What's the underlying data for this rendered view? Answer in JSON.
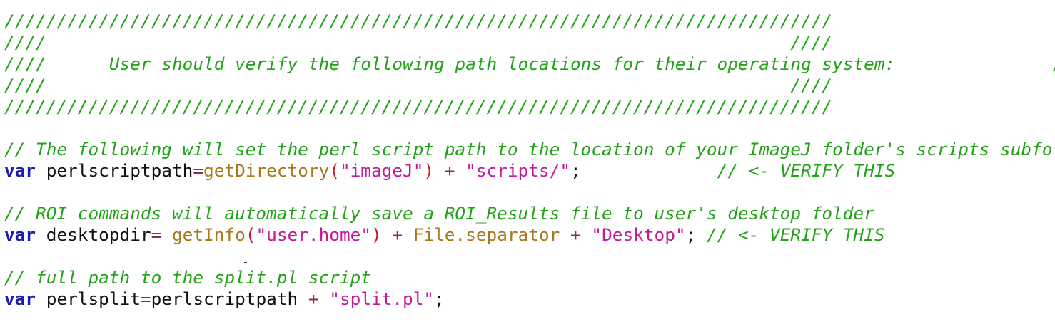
{
  "editor": {
    "colors": {
      "comment": "#22a317",
      "keyword": "#1d1dad",
      "function": "#a8791a",
      "string": "#c41a9a",
      "paren": "#c41a2b",
      "operator": "#8a2b5a"
    },
    "banner": {
      "border": "///////////////////////////////////////////////////////////////////////////////",
      "blank": "////                                                                       ////",
      "message": "////      User should verify the following path locations for their operating system:               ////"
    },
    "block1": {
      "comment": "// The following will set the perl script path to the location of your ImageJ folder's scripts subfolder",
      "keyword": "var",
      "name": "perlscriptpath",
      "eq": "=",
      "fn": "getDirectory",
      "popen": "(",
      "arg": "\"imageJ\"",
      "pclose": ")",
      "plus": " + ",
      "str": "\"scripts/\"",
      "semi": ";",
      "pad": "             ",
      "trail": "// <- VERIFY THIS"
    },
    "block2": {
      "comment": "// ROI commands will automatically save a ROI_Results file to user's desktop folder",
      "keyword": "var",
      "name": "desktopdir",
      "eq": "= ",
      "fn": "getInfo",
      "popen": "(",
      "arg": "\"user.home\"",
      "pclose": ")",
      "plus1": " + ",
      "ref": "File.separator",
      "plus2": " + ",
      "str": "\"Desktop\"",
      "semi": "; ",
      "trail": "// <- VERIFY THIS"
    },
    "block3": {
      "comment": "// full path to the split.pl script",
      "keyword": "var",
      "name": "perlsplit",
      "eq": "=",
      "ref": "perlscriptpath",
      "plus": " + ",
      "str": "\"split.pl\"",
      "semi": ";"
    }
  }
}
